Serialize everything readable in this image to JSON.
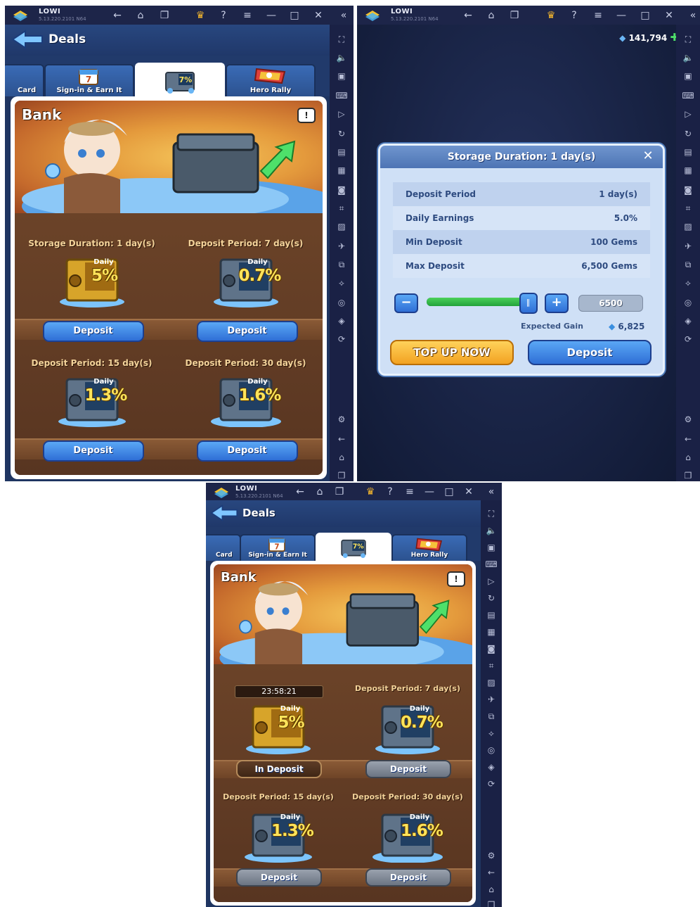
{
  "app": {
    "name": "LOWI",
    "version": "5.13.220.2101 N64"
  },
  "header": {
    "title": "Deals"
  },
  "tabs": [
    {
      "label": "Card"
    },
    {
      "label": "Sign-in & Earn It"
    },
    {
      "label": "7%"
    },
    {
      "label": "Hero Rally"
    }
  ],
  "bank": {
    "title": "Bank",
    "info": "!"
  },
  "slots": [
    {
      "label": "Storage Duration: 1 day(s)",
      "daily": "Daily",
      "rate": "5%",
      "button": "Deposit"
    },
    {
      "label": "Deposit Period: 7 day(s)",
      "daily": "Daily",
      "rate": "0.7%",
      "button": "Deposit"
    },
    {
      "label": "Deposit Period: 15 day(s)",
      "daily": "Daily",
      "rate": "1.3%",
      "button": "Deposit"
    },
    {
      "label": "Deposit Period: 30 day(s)",
      "daily": "Daily",
      "rate": "1.6%",
      "button": "Deposit"
    }
  ],
  "slots_after": [
    {
      "timer": "23:58:21",
      "daily": "Daily",
      "rate": "5%",
      "button": "In Deposit"
    },
    {
      "label": "Deposit Period: 7 day(s)",
      "daily": "Daily",
      "rate": "0.7%",
      "button": "Deposit"
    },
    {
      "label": "Deposit Period: 15 day(s)",
      "daily": "Daily",
      "rate": "1.3%",
      "button": "Deposit"
    },
    {
      "label": "Deposit Period: 30 day(s)",
      "daily": "Daily",
      "rate": "1.6%",
      "button": "Deposit"
    }
  ],
  "gems": "141,794",
  "modal": {
    "title": "Storage Duration: 1 day(s)",
    "close": "✕",
    "rows": [
      {
        "k": "Deposit Period",
        "v": "1 day(s)"
      },
      {
        "k": "Daily Earnings",
        "v": "5.0%"
      },
      {
        "k": "Min Deposit",
        "v": "100 Gems"
      },
      {
        "k": "Max Deposit",
        "v": "6,500 Gems"
      }
    ],
    "slider_fraction": 0.95,
    "amount": "6500",
    "expected_label": "Expected Gain",
    "expected_value": "6,825",
    "topup_label": "TOP UP NOW",
    "deposit_label": "Deposit"
  },
  "colors": {
    "accent": "#2f6fd6",
    "topup": "#f2a222",
    "wood": "#5b3722",
    "gold": "#f3d39a"
  }
}
